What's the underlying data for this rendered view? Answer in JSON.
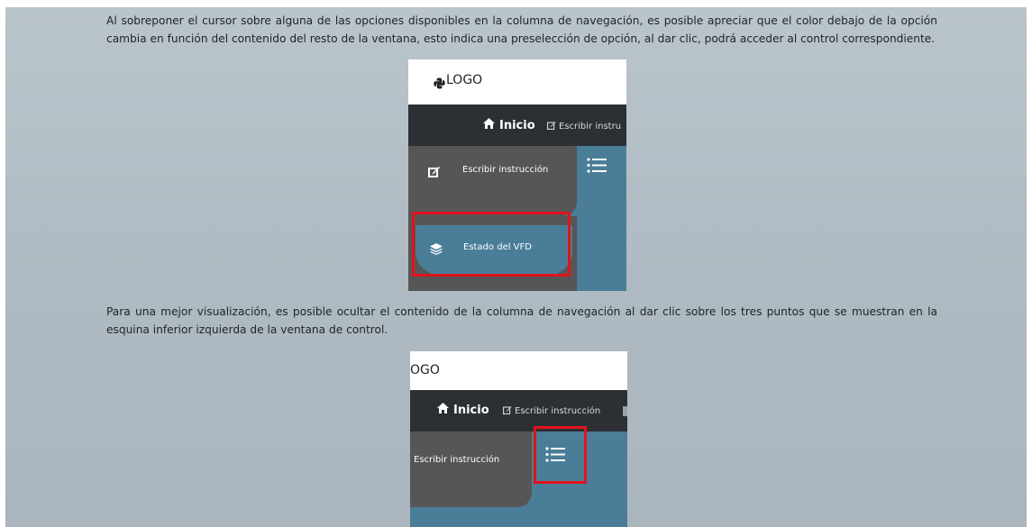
{
  "paragraphs": {
    "p1": "Al sobreponer el cursor sobre alguna de las opciones disponibles en la columna de navegación, es posible apreciar que el color debajo de la opción cambia en función del contenido del resto de la ventana, esto indica una preselección de opción, al dar clic, podrá acceder al control correspondiente.",
    "p2": "Para una mejor visualización, es posible ocultar el contenido de la columna de navegación al dar clic sobre los tres puntos que se muestran en la esquina inferior izquierda de la ventana de control."
  },
  "screenshot1": {
    "logo": "LOGO",
    "nav_home": "Inicio",
    "nav_write": "Escribir instru",
    "sidebar_item_1": "Escribir instrucción",
    "sidebar_item_2": "Estado del VFD"
  },
  "screenshot2": {
    "logo": "OGO",
    "nav_home": "Inicio",
    "nav_write": "Escribir instrucción",
    "sidebar_item_1": "Escribir instrucción"
  },
  "colors": {
    "page_bg": "#b0bbc3",
    "nav_bg": "#2c3034",
    "sidebar_bg": "#565656",
    "content_bg": "#4a7d98",
    "highlight": "#e3121a"
  },
  "icons": [
    "python-logo-icon",
    "home-icon",
    "edit-icon",
    "layers-icon",
    "list-icon"
  ]
}
